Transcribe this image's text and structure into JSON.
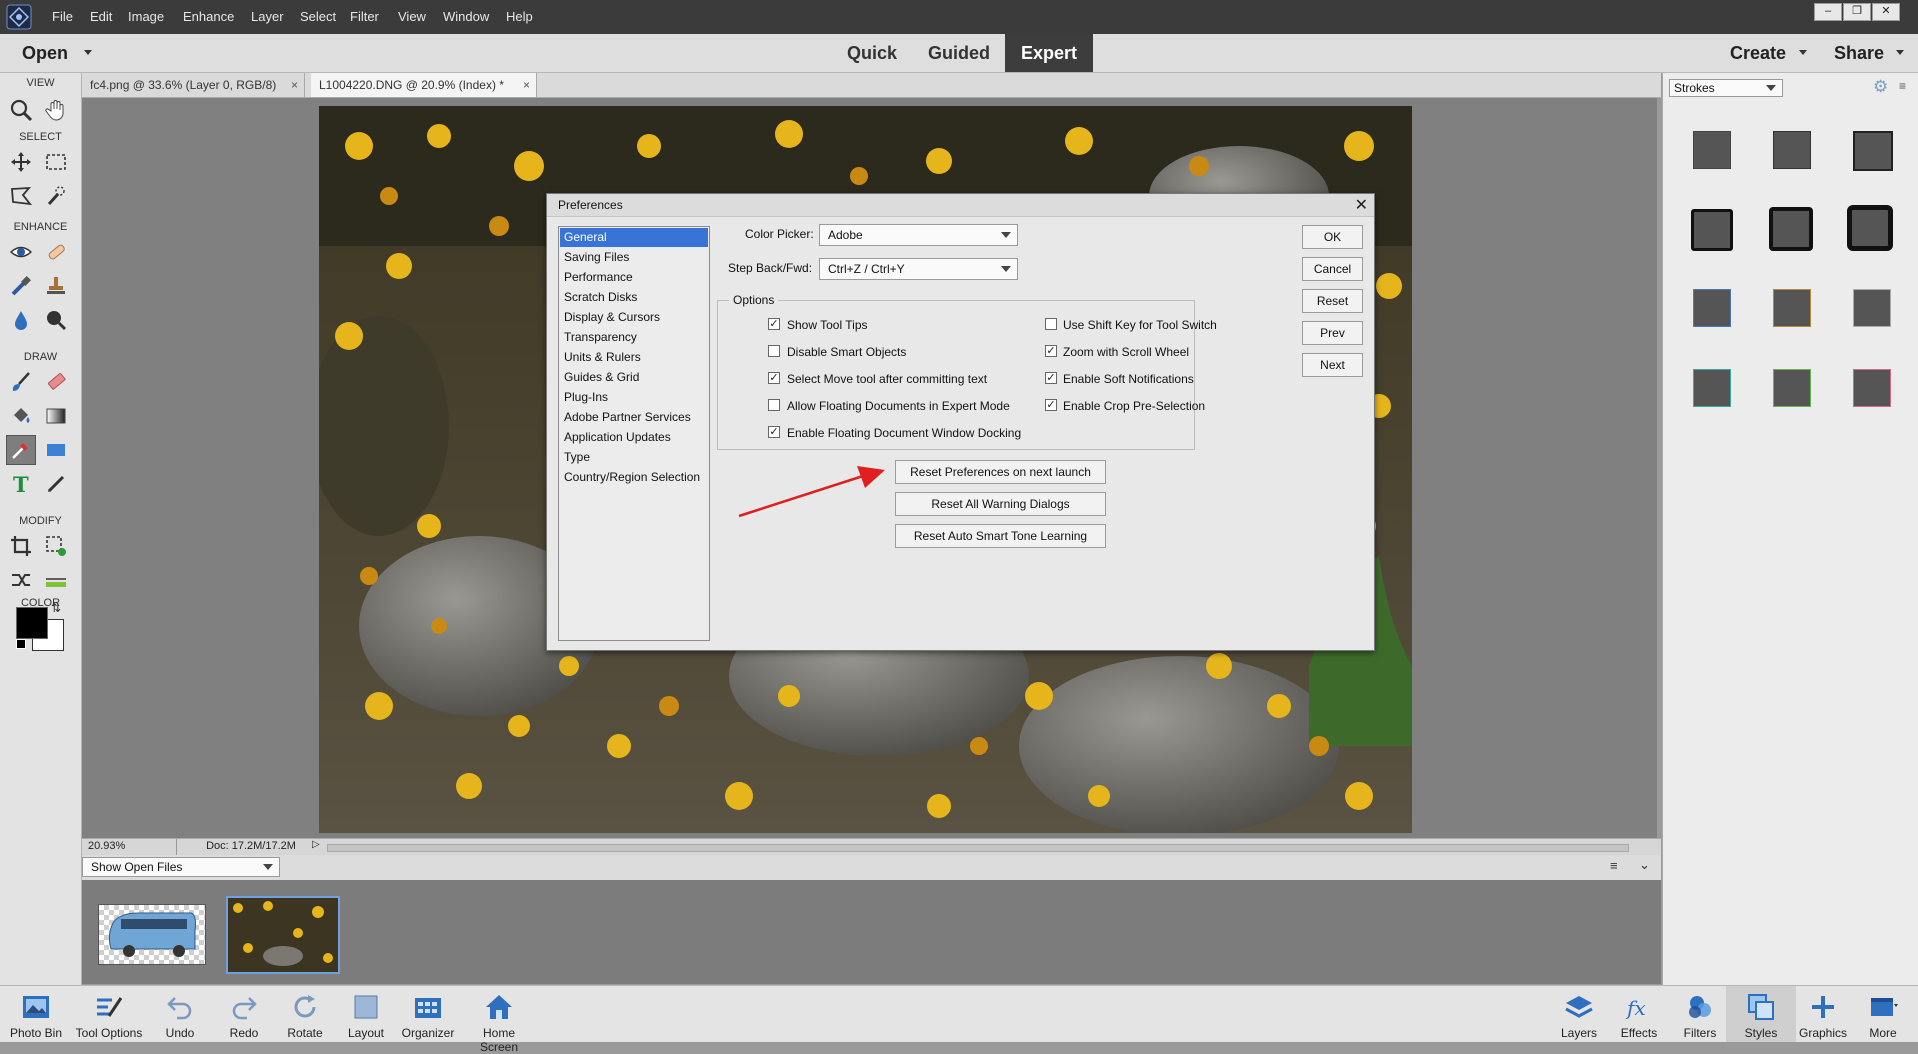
{
  "menubar": {
    "items": [
      "File",
      "Edit",
      "Image",
      "Enhance",
      "Layer",
      "Select",
      "Filter",
      "View",
      "Window",
      "Help"
    ]
  },
  "modebar": {
    "open_label": "Open",
    "modes": [
      "Quick",
      "Guided",
      "Expert"
    ],
    "active_mode": "Expert",
    "create_label": "Create",
    "share_label": "Share"
  },
  "toolbox": {
    "sections": [
      "VIEW",
      "SELECT",
      "ENHANCE",
      "DRAW",
      "MODIFY",
      "COLOR"
    ],
    "foreground_color": "#000000",
    "background_color": "#ffffff"
  },
  "tabs": [
    {
      "label": "fc4.png @ 33.6% (Layer 0, RGB/8)",
      "close": "×"
    },
    {
      "label": "L1004220.DNG @ 20.9% (Index) *",
      "close": "×"
    }
  ],
  "status": {
    "zoom": "20.93%",
    "doc": "Doc: 17.2M/17.2M"
  },
  "photobin": {
    "dropdown": "Show Open Files"
  },
  "right_panel": {
    "dropdown": "Strokes"
  },
  "bottom_bar": {
    "left": [
      "Photo Bin",
      "Tool Options",
      "Undo",
      "Redo",
      "Rotate",
      "Layout",
      "Organizer",
      "Home Screen"
    ],
    "right": [
      "Layers",
      "Effects",
      "Filters",
      "Styles",
      "Graphics",
      "More"
    ]
  },
  "preferences": {
    "title": "Preferences",
    "categories": [
      "General",
      "Saving Files",
      "Performance",
      "Scratch Disks",
      "Display & Cursors",
      "Transparency",
      "Units & Rulers",
      "Guides & Grid",
      "Plug-Ins",
      "Adobe Partner Services",
      "Application Updates",
      "Type",
      "Country/Region Selection"
    ],
    "selected_category": "General",
    "color_picker_label": "Color Picker:",
    "color_picker_value": "Adobe",
    "step_label": "Step Back/Fwd:",
    "step_value": "Ctrl+Z / Ctrl+Y",
    "options_title": "Options",
    "options_left": [
      {
        "label": "Show Tool Tips",
        "checked": true
      },
      {
        "label": "Disable Smart Objects",
        "checked": false
      },
      {
        "label": "Select Move tool after committing text",
        "checked": true
      },
      {
        "label": "Allow Floating Documents in Expert Mode",
        "checked": false
      },
      {
        "label": "Enable Floating Document Window Docking",
        "checked": true
      }
    ],
    "options_right": [
      {
        "label": "Use Shift Key for Tool Switch",
        "checked": false
      },
      {
        "label": "Zoom with Scroll Wheel",
        "checked": true
      },
      {
        "label": "Enable Soft Notifications",
        "checked": true
      },
      {
        "label": "Enable Crop Pre-Selection",
        "checked": true
      }
    ],
    "reset_buttons": [
      "Reset Preferences on next launch",
      "Reset All Warning Dialogs",
      "Reset Auto Smart Tone Learning"
    ],
    "side_buttons": [
      "OK",
      "Cancel",
      "Reset",
      "Prev",
      "Next"
    ],
    "arrow_color": "#e02020"
  }
}
